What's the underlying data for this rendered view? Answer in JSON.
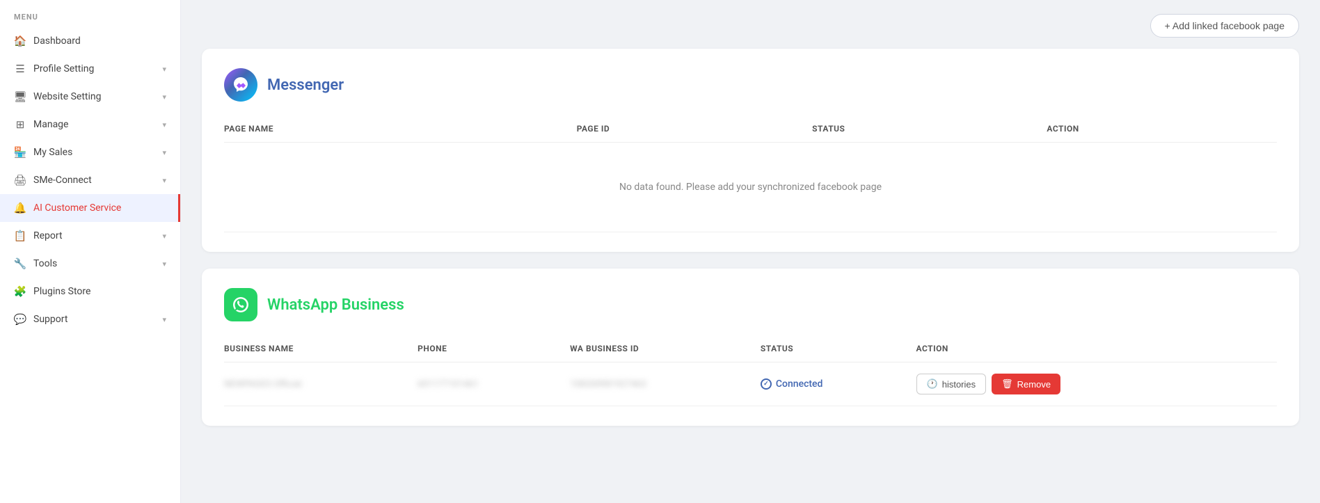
{
  "sidebar": {
    "menu_label": "MENU",
    "items": [
      {
        "id": "dashboard",
        "label": "Dashboard",
        "icon": "🏠",
        "has_chevron": false,
        "active": false
      },
      {
        "id": "profile-setting",
        "label": "Profile Setting",
        "icon": "☰",
        "has_chevron": true,
        "active": false
      },
      {
        "id": "website-setting",
        "label": "Website Setting",
        "icon": "🖥",
        "has_chevron": true,
        "active": false
      },
      {
        "id": "manage",
        "label": "Manage",
        "icon": "⊞",
        "has_chevron": true,
        "active": false
      },
      {
        "id": "my-sales",
        "label": "My Sales",
        "icon": "🏪",
        "has_chevron": true,
        "active": false
      },
      {
        "id": "sme-connect",
        "label": "SMе-Connect",
        "icon": "🖨",
        "has_chevron": true,
        "active": false
      },
      {
        "id": "ai-customer-service",
        "label": "AI Customer Service",
        "icon": "🔔",
        "has_chevron": false,
        "active": true
      },
      {
        "id": "report",
        "label": "Report",
        "icon": "📋",
        "has_chevron": true,
        "active": false
      },
      {
        "id": "tools",
        "label": "Tools",
        "icon": "🔧",
        "has_chevron": true,
        "active": false
      },
      {
        "id": "plugins-store",
        "label": "Plugins Store",
        "icon": "🧩",
        "has_chevron": false,
        "active": false
      },
      {
        "id": "support",
        "label": "Support",
        "icon": "💬",
        "has_chevron": true,
        "active": false
      }
    ]
  },
  "topbar": {
    "add_fb_label": "+ Add linked facebook page"
  },
  "messenger_section": {
    "title": "Messenger",
    "columns": [
      "PAGE NAME",
      "PAGE ID",
      "STATUS",
      "ACTION"
    ],
    "no_data_message": "No data found. Please add your synchronized facebook page",
    "rows": []
  },
  "whatsapp_section": {
    "title": "WhatsApp Business",
    "columns": [
      "BUSINESS NAME",
      "PHONE",
      "WA BUSINESS ID",
      "STATUS",
      "ACTION"
    ],
    "rows": [
      {
        "business_name": "NEWPAGES Official",
        "phone": "601177101461",
        "wa_business_id": "108200981927463",
        "status": "Connected",
        "actions": [
          "histories",
          "Remove"
        ]
      }
    ],
    "histories_label": "histories",
    "remove_label": "Remove"
  }
}
